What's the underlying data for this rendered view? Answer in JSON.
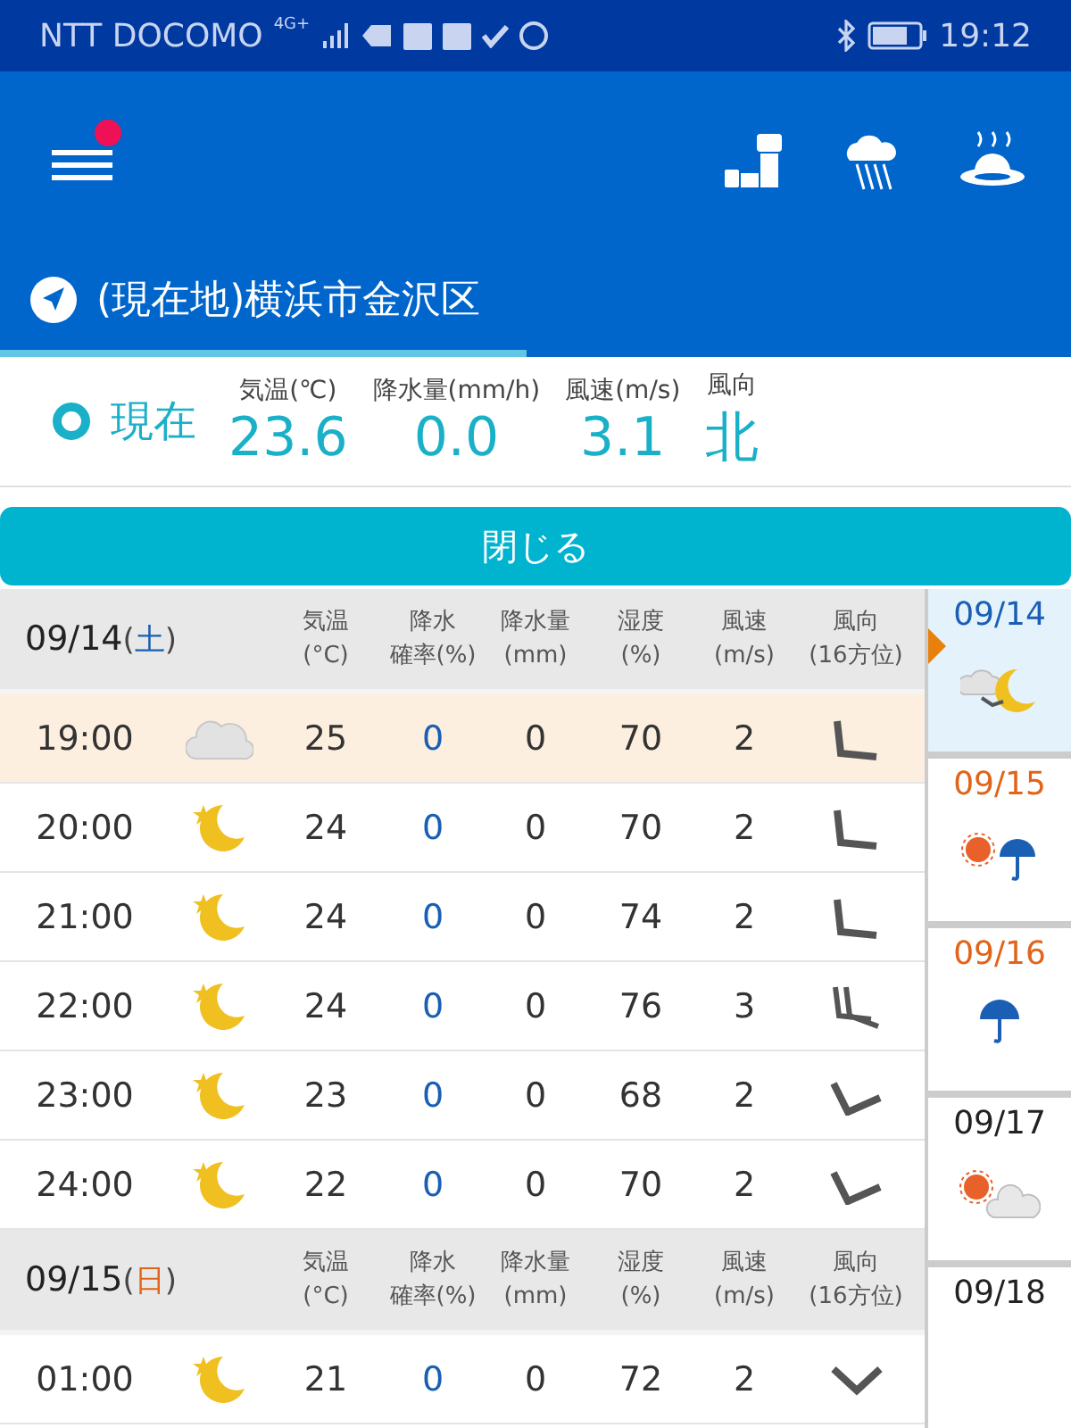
{
  "status_bar": {
    "carrier": "NTT DOCOMO",
    "network": "4G+",
    "time": "19:12"
  },
  "header": {
    "menu_badge": true
  },
  "location": {
    "name": "(現在地)横浜市金沢区"
  },
  "current": {
    "label": "現在",
    "metrics": [
      {
        "label": "気温(℃)",
        "value": "23.6"
      },
      {
        "label": "降水量(mm/h)",
        "value": "0.0"
      },
      {
        "label": "風速(m/s)",
        "value": "3.1"
      },
      {
        "label": "風向",
        "value": "北"
      }
    ]
  },
  "close_button": "閉じる",
  "days": [
    {
      "date": "09/14",
      "paren_open": "(",
      "weekday": "土",
      "paren_close": ")",
      "color": "#1a5fb4",
      "columns": [
        {
          "line1": "気温",
          "line2": "(°C)"
        },
        {
          "line1": "降水",
          "line2": "確率(%)"
        },
        {
          "line1": "降水量",
          "line2": "(mm)"
        },
        {
          "line1": "湿度",
          "line2": "(%)"
        },
        {
          "line1": "風速",
          "line2": "(m/s)"
        },
        {
          "line1": "風向",
          "line2": "(16方位)"
        }
      ],
      "rows": [
        {
          "time": "19:00",
          "weather": {
            "kind": "cloud"
          },
          "temp": "25",
          "prob": "0",
          "amount": "0",
          "humidity": "70",
          "wind": "2",
          "direction": {
            "kind": "corner"
          },
          "current": true
        },
        {
          "time": "20:00",
          "weather": {
            "kind": "moon"
          },
          "temp": "24",
          "prob": "0",
          "amount": "0",
          "humidity": "70",
          "wind": "2",
          "direction": {
            "kind": "corner"
          },
          "current": false
        },
        {
          "time": "21:00",
          "weather": {
            "kind": "moon"
          },
          "temp": "24",
          "prob": "0",
          "amount": "0",
          "humidity": "74",
          "wind": "2",
          "direction": {
            "kind": "corner"
          },
          "current": false
        },
        {
          "time": "22:00",
          "weather": {
            "kind": "moon"
          },
          "temp": "24",
          "prob": "0",
          "amount": "0",
          "humidity": "76",
          "wind": "3",
          "direction": {
            "kind": "double"
          },
          "current": false
        },
        {
          "time": "23:00",
          "weather": {
            "kind": "moon"
          },
          "temp": "23",
          "prob": "0",
          "amount": "0",
          "humidity": "68",
          "wind": "2",
          "direction": {
            "kind": "tilted"
          },
          "current": false
        },
        {
          "time": "24:00",
          "weather": {
            "kind": "moon"
          },
          "temp": "22",
          "prob": "0",
          "amount": "0",
          "humidity": "70",
          "wind": "2",
          "direction": {
            "kind": "tilted"
          },
          "current": false
        }
      ]
    },
    {
      "date": "09/15",
      "paren_open": "(",
      "weekday": "日",
      "paren_close": ")",
      "color": "#e0651a",
      "columns": [
        {
          "line1": "気温",
          "line2": "(°C)"
        },
        {
          "line1": "降水",
          "line2": "確率(%)"
        },
        {
          "line1": "降水量",
          "line2": "(mm)"
        },
        {
          "line1": "湿度",
          "line2": "(%)"
        },
        {
          "line1": "風速",
          "line2": "(m/s)"
        },
        {
          "line1": "風向",
          "line2": "(16方位)"
        }
      ],
      "rows": [
        {
          "time": "01:00",
          "weather": {
            "kind": "moon"
          },
          "temp": "21",
          "prob": "0",
          "amount": "0",
          "humidity": "72",
          "wind": "2",
          "direction": {
            "kind": "chevron"
          },
          "current": false
        }
      ]
    }
  ],
  "sidebar": [
    {
      "date": "09/14",
      "color": "#1a5fb4",
      "kind": "cloudmoon",
      "selected": true
    },
    {
      "date": "09/15",
      "color": "#e0651a",
      "kind": "sunrain",
      "selected": false
    },
    {
      "date": "09/16",
      "color": "#e0651a",
      "kind": "rain",
      "selected": false
    },
    {
      "date": "09/17",
      "color": "#222222",
      "kind": "suncloud",
      "selected": false
    },
    {
      "date": "09/18",
      "color": "#222222",
      "selected": false
    }
  ]
}
